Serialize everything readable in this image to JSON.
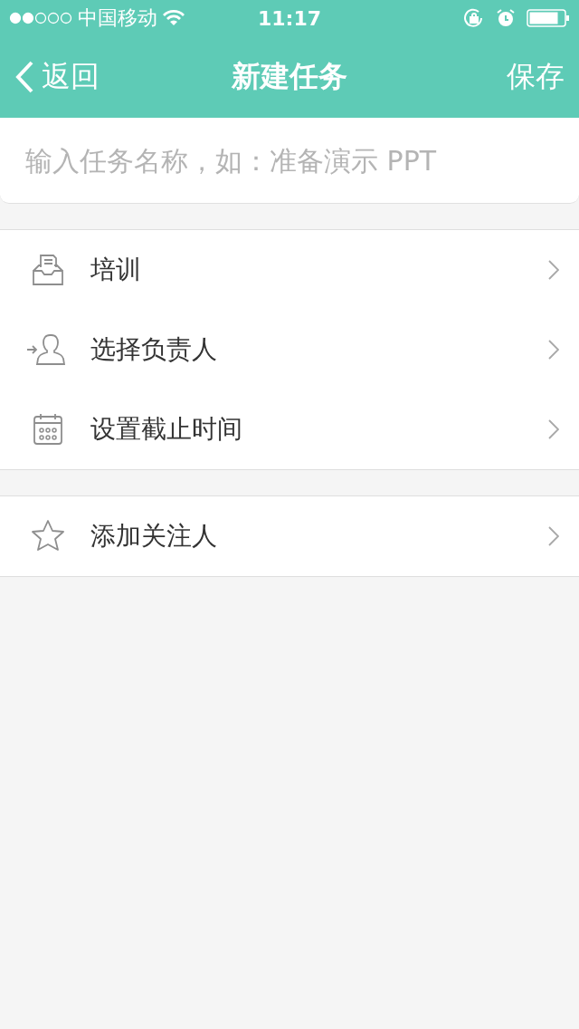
{
  "status_bar": {
    "carrier": "中国移动",
    "time": "11:17"
  },
  "nav": {
    "back": "返回",
    "title": "新建任务",
    "action": "保存"
  },
  "task_name": {
    "placeholder": "输入任务名称，如：准备演示 PPT"
  },
  "groups": [
    {
      "items": [
        {
          "label": "培训"
        },
        {
          "label": "选择负责人"
        },
        {
          "label": "设置截止时间"
        }
      ]
    },
    {
      "items": [
        {
          "label": "添加关注人"
        }
      ]
    }
  ]
}
